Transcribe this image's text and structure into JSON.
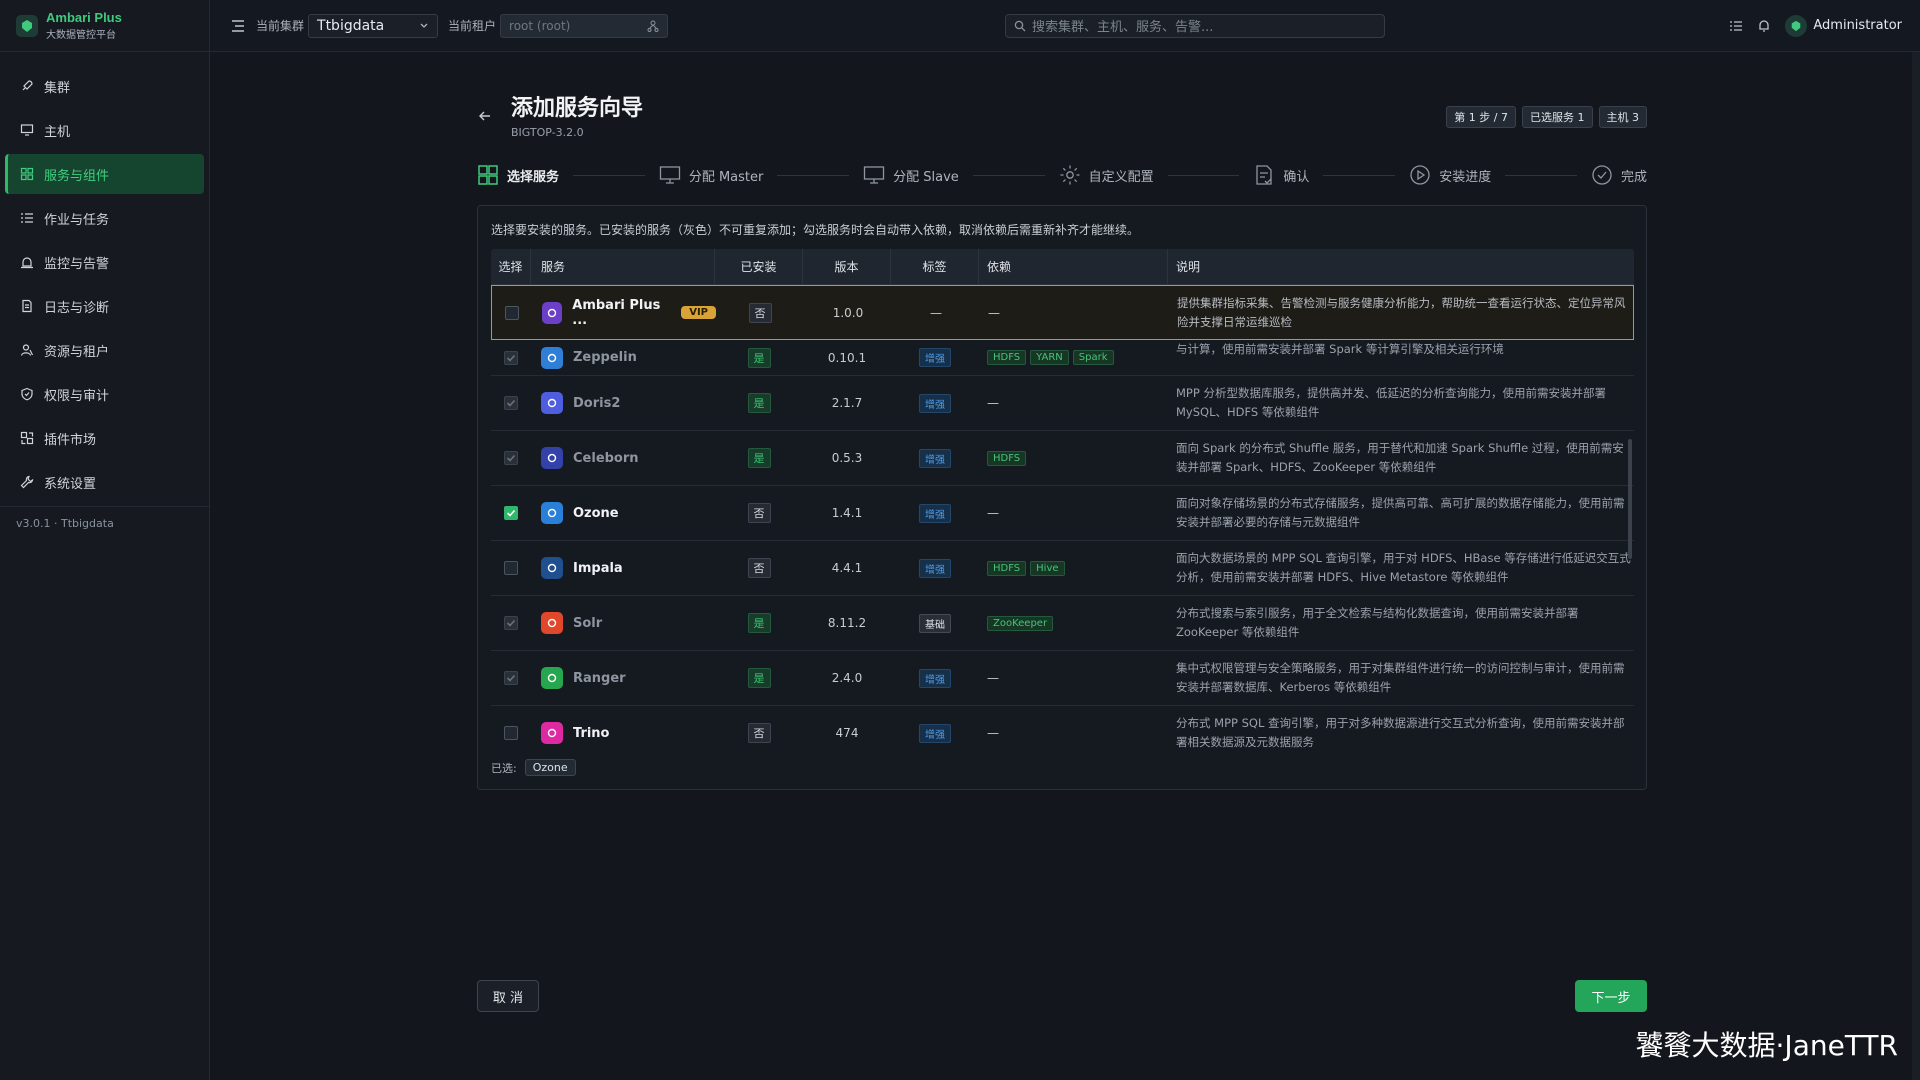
{
  "brand": {
    "title": "Ambari Plus",
    "subtitle": "大数据管控平台"
  },
  "nav": [
    {
      "label": "集群",
      "icon": "rocket-icon",
      "active": false
    },
    {
      "label": "主机",
      "icon": "monitor-icon",
      "active": false
    },
    {
      "label": "服务与组件",
      "icon": "grid-icon",
      "active": true
    },
    {
      "label": "作业与任务",
      "icon": "list-icon",
      "active": false
    },
    {
      "label": "监控与告警",
      "icon": "alarm-icon",
      "active": false
    },
    {
      "label": "日志与诊断",
      "icon": "log-icon",
      "active": false
    },
    {
      "label": "资源与租户",
      "icon": "users-icon",
      "active": false
    },
    {
      "label": "权限与审计",
      "icon": "shield-icon",
      "active": false
    },
    {
      "label": "插件市场",
      "icon": "plugin-icon",
      "active": false
    },
    {
      "label": "系统设置",
      "icon": "wrench-icon",
      "active": false
    }
  ],
  "version": "v3.0.1 · Ttbigdata",
  "topbar": {
    "cluster_label": "当前集群",
    "cluster_value": "Ttbigdata",
    "tenant_label": "当前租户",
    "tenant_value": "root (root)",
    "search_placeholder": "搜索集群、主机、服务、告警...",
    "user": "Administrator"
  },
  "page": {
    "title": "添加服务向导",
    "subtitle": "BIGTOP-3.2.0",
    "badges": [
      "第 1 步 / 7",
      "已选服务 1",
      "主机 3"
    ]
  },
  "steps": [
    {
      "label": "选择服务",
      "icon": "grid-icon",
      "active": true
    },
    {
      "label": "分配 Master",
      "icon": "monitor-icon",
      "active": false
    },
    {
      "label": "分配 Slave",
      "icon": "monitor-icon",
      "active": false
    },
    {
      "label": "自定义配置",
      "icon": "gear-icon",
      "active": false
    },
    {
      "label": "确认",
      "icon": "checklist-icon",
      "active": false
    },
    {
      "label": "安装进度",
      "icon": "play-icon",
      "active": false
    },
    {
      "label": "完成",
      "icon": "check-circle-icon",
      "active": false
    }
  ],
  "hint": "选择要安装的服务。已安装的服务（灰色）不可重复添加；勾选服务时会自动带入依赖，取消依赖后需重新补齐才能继续。",
  "table": {
    "headers": [
      "选择",
      "服务",
      "已安装",
      "版本",
      "标签",
      "依赖",
      "说明"
    ],
    "rows": [
      {
        "name": "Ambari Plus ...",
        "vip": "VIP",
        "installed": "否",
        "version": "1.0.0",
        "tag": "—",
        "deps": [],
        "dep_dash": "—",
        "desc": "提供集群指标采集、告警检测与服务健康分析能力，帮助统一查看运行状态、定位异常风险并支撑日常运维巡检",
        "color": "#6b3fc8"
      },
      {
        "name": "Zeppelin",
        "installed": "是",
        "version": "0.10.1",
        "tag": "增强",
        "deps": [
          "HDFS",
          "YARN",
          "Spark"
        ],
        "desc": "与计算，使用前需安装并部署 Spark 等计算引擎及相关运行环境",
        "color": "#2f7fd6"
      },
      {
        "name": "Doris2",
        "installed": "是",
        "version": "2.1.7",
        "tag": "增强",
        "deps": [],
        "dep_dash": "—",
        "desc": "MPP 分析型数据库服务，提供高并发、低延迟的分析查询能力，使用前需安装并部署 MySQL、HDFS 等依赖组件",
        "color": "#4f5de0"
      },
      {
        "name": "Celeborn",
        "installed": "是",
        "version": "0.5.3",
        "tag": "增强",
        "deps": [
          "HDFS"
        ],
        "desc": "面向 Spark 的分布式 Shuffle 服务，用于替代和加速 Spark Shuffle 过程，使用前需安装并部署 Spark、HDFS、ZooKeeper 等依赖组件",
        "color": "#3441a8"
      },
      {
        "name": "Ozone",
        "installed": "否",
        "version": "1.4.1",
        "tag": "增强",
        "deps": [],
        "dep_dash": "—",
        "desc": "面向对象存储场景的分布式存储服务，提供高可靠、高可扩展的数据存储能力，使用前需安装并部署必要的存储与元数据组件",
        "color": "#2a7fd8",
        "checked": true
      },
      {
        "name": "Impala",
        "installed": "否",
        "version": "4.4.1",
        "tag": "增强",
        "deps": [
          "HDFS",
          "Hive"
        ],
        "desc": "面向大数据场景的 MPP SQL 查询引擎，用于对 HDFS、HBase 等存储进行低延迟交互式分析，使用前需安装并部署 HDFS、Hive Metastore 等依赖组件",
        "color": "#1f4f8f"
      },
      {
        "name": "Solr",
        "installed": "是",
        "version": "8.11.2",
        "tag": "基础",
        "deps": [
          "ZooKeeper"
        ],
        "desc": "分布式搜索与索引服务，用于全文检索与结构化数据查询，使用前需安装并部署 ZooKeeper 等依赖组件",
        "color": "#e0472b"
      },
      {
        "name": "Ranger",
        "installed": "是",
        "version": "2.4.0",
        "tag": "增强",
        "deps": [],
        "dep_dash": "—",
        "desc": "集中式权限管理与安全策略服务，用于对集群组件进行统一的访问控制与审计，使用前需安装并部署数据库、Kerberos 等依赖组件",
        "color": "#26a64f"
      },
      {
        "name": "Trino",
        "installed": "否",
        "version": "474",
        "tag": "增强",
        "deps": [],
        "dep_dash": "—",
        "desc": "分布式 MPP SQL 查询引擎，用于对多种数据源进行交互式分析查询，使用前需安装并部署相关数据源及元数据服务",
        "color": "#dd2aa3"
      }
    ]
  },
  "selected_label": "已选:",
  "selected_items": [
    "Ozone"
  ],
  "buttons": {
    "cancel": "取 消",
    "next": "下一步"
  },
  "watermark": "饕餮大数据·JaneTTR"
}
